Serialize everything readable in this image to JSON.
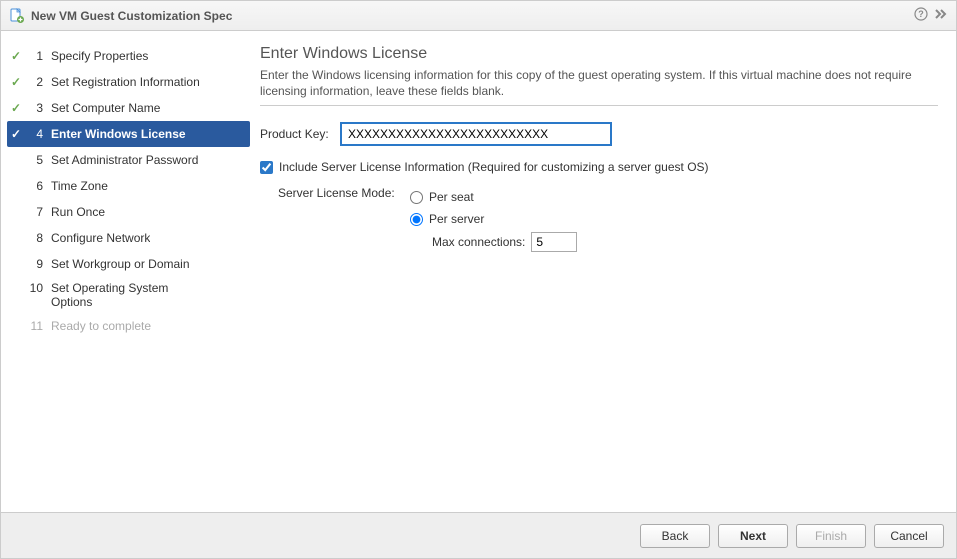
{
  "title": "New VM Guest Customization Spec",
  "steps": [
    {
      "num": "1",
      "label": "Specify Properties",
      "done": true
    },
    {
      "num": "2",
      "label": "Set Registration Information",
      "done": true
    },
    {
      "num": "3",
      "label": "Set Computer Name",
      "done": true
    },
    {
      "num": "4",
      "label": "Enter Windows License",
      "done": true,
      "active": true
    },
    {
      "num": "5",
      "label": "Set Administrator Password"
    },
    {
      "num": "6",
      "label": "Time Zone"
    },
    {
      "num": "7",
      "label": "Run Once"
    },
    {
      "num": "8",
      "label": "Configure Network"
    },
    {
      "num": "9",
      "label": "Set Workgroup or Domain"
    },
    {
      "num": "10",
      "label": "Set Operating System Options"
    },
    {
      "num": "11",
      "label": "Ready to complete",
      "disabled": true
    }
  ],
  "panel": {
    "heading": "Enter Windows License",
    "description": "Enter the Windows licensing information for this copy of the guest operating system. If this virtual machine does not require licensing information, leave these fields blank.",
    "productKeyLabel": "Product Key:",
    "productKeyValue": "XXXXXXXXXXXXXXXXXXXXXXXXX",
    "includeServerLabel": "Include Server License Information (Required for customizing a server guest OS)",
    "serverModeLabel": "Server License Mode:",
    "perSeatLabel": "Per seat",
    "perServerLabel": "Per server",
    "maxConnLabel": "Max connections:",
    "maxConnValue": "5"
  },
  "footer": {
    "back": "Back",
    "next": "Next",
    "finish": "Finish",
    "cancel": "Cancel"
  }
}
